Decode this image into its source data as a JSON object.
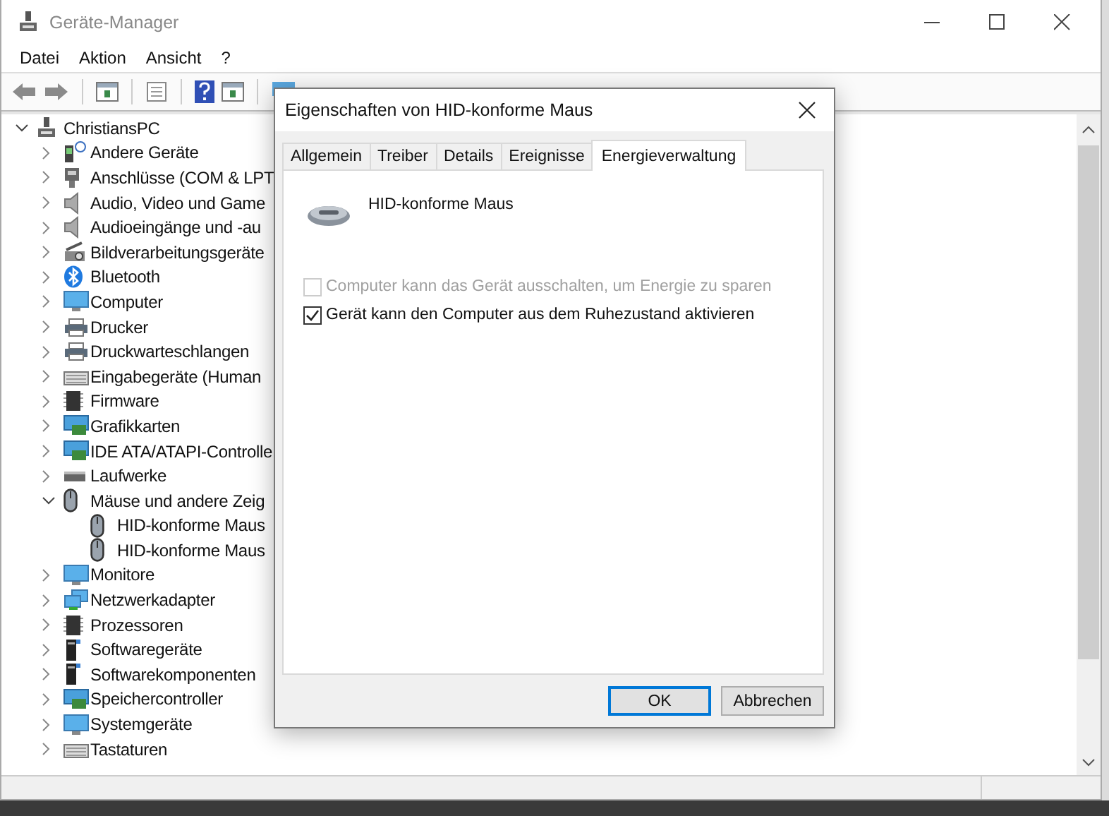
{
  "window": {
    "title": "Geräte-Manager"
  },
  "menu": [
    "Datei",
    "Aktion",
    "Ansicht",
    "?"
  ],
  "toolbar": [
    {
      "kind": "back"
    },
    {
      "kind": "forward"
    },
    {
      "kind": "panel"
    },
    {
      "kind": "sheet"
    },
    {
      "kind": "help"
    },
    {
      "kind": "panel"
    },
    {
      "kind": "monitor"
    }
  ],
  "tree": {
    "label": "ChristiansPC",
    "kind": "computer",
    "expanded": true,
    "children": [
      {
        "label": "Andere Geräte",
        "kind": "unknown",
        "expanded": false
      },
      {
        "label": "Anschlüsse (COM & LPT",
        "kind": "port",
        "expanded": false
      },
      {
        "label": "Audio, Video und Game",
        "kind": "speaker",
        "expanded": false
      },
      {
        "label": "Audioeingänge und -au",
        "kind": "speaker",
        "expanded": false
      },
      {
        "label": "Bildverarbeitungsgeräte",
        "kind": "camera",
        "expanded": false
      },
      {
        "label": "Bluetooth",
        "kind": "bluetooth",
        "expanded": false
      },
      {
        "label": "Computer",
        "kind": "monitor",
        "expanded": false
      },
      {
        "label": "Drucker",
        "kind": "printer",
        "expanded": false
      },
      {
        "label": "Druckwarteschlangen",
        "kind": "printer",
        "expanded": false
      },
      {
        "label": "Eingabegeräte (Human",
        "kind": "keyboard",
        "expanded": false
      },
      {
        "label": "Firmware",
        "kind": "chip",
        "expanded": false
      },
      {
        "label": "Grafikkarten",
        "kind": "card",
        "expanded": false
      },
      {
        "label": "IDE ATA/ATAPI-Controlle",
        "kind": "card",
        "expanded": false
      },
      {
        "label": "Laufwerke",
        "kind": "drive",
        "expanded": false
      },
      {
        "label": "Mäuse und andere Zeig",
        "kind": "mouse",
        "expanded": true,
        "children": [
          {
            "label": "HID-konforme Maus",
            "kind": "mouse"
          },
          {
            "label": "HID-konforme Maus",
            "kind": "mouse"
          }
        ]
      },
      {
        "label": "Monitore",
        "kind": "monitor",
        "expanded": false
      },
      {
        "label": "Netzwerkadapter",
        "kind": "network",
        "expanded": false
      },
      {
        "label": "Prozessoren",
        "kind": "chip",
        "expanded": false
      },
      {
        "label": "Softwaregeräte",
        "kind": "tower",
        "expanded": false
      },
      {
        "label": "Softwarekomponenten",
        "kind": "tower",
        "expanded": false
      },
      {
        "label": "Speichercontroller",
        "kind": "card",
        "expanded": false
      },
      {
        "label": "Systemgeräte",
        "kind": "monitor",
        "expanded": false
      },
      {
        "label": "Tastaturen",
        "kind": "keyboard",
        "expanded": false
      }
    ]
  },
  "dialog": {
    "title": "Eigenschaften von HID-konforme Maus",
    "tabs": [
      {
        "label": "Allgemein",
        "selected": false
      },
      {
        "label": "Treiber",
        "selected": false
      },
      {
        "label": "Details",
        "selected": false
      },
      {
        "label": "Ereignisse",
        "selected": false
      },
      {
        "label": "Energieverwaltung",
        "selected": true
      }
    ],
    "device_name": "HID-konforme Maus",
    "options": [
      {
        "label": "Computer kann das Gerät ausschalten, um Energie zu sparen",
        "checked": false,
        "disabled": true
      },
      {
        "label": "Gerät kann den Computer aus dem Ruhezustand aktivieren",
        "checked": true,
        "disabled": false
      }
    ],
    "buttons": [
      {
        "label": "OK",
        "default": true
      },
      {
        "label": "Abbrechen",
        "default": false
      }
    ]
  }
}
